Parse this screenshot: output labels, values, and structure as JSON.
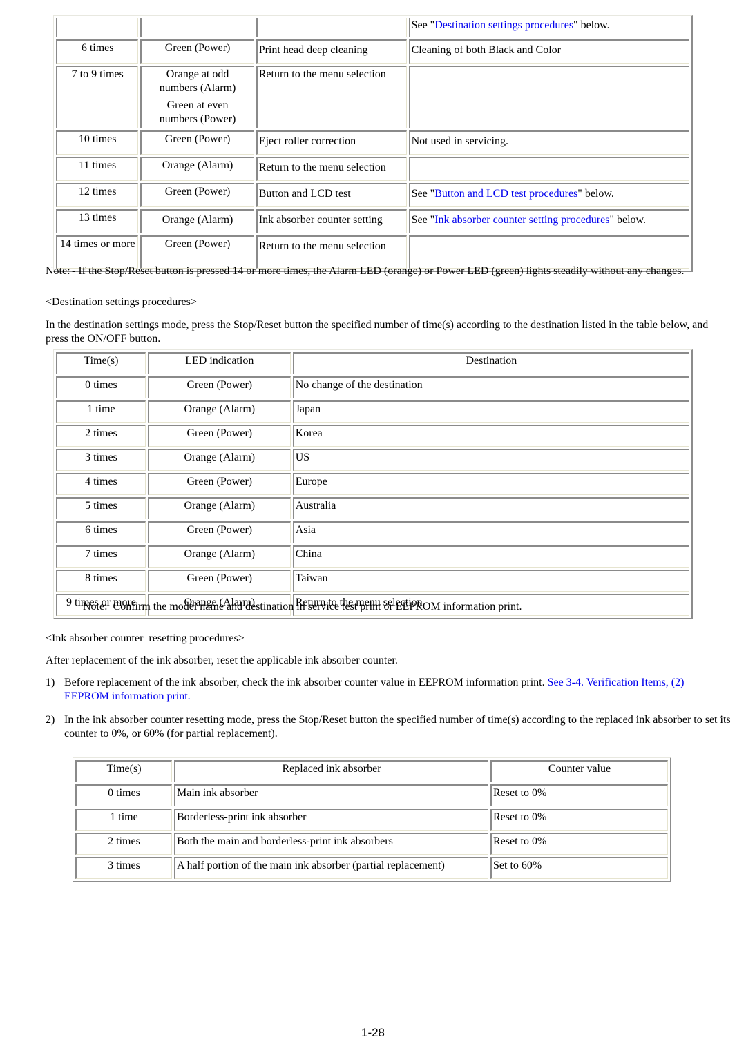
{
  "menu_table": {
    "rows": [
      {
        "times": "",
        "led": [],
        "function": "",
        "remarks_prefix": "See \"",
        "remarks_link": "Destination settings procedures",
        "remarks_suffix": "\" below."
      },
      {
        "times": "6 times",
        "led": [
          "Green (Power)"
        ],
        "function": "Print head deep cleaning",
        "remarks_text": "Cleaning of both Black and Color"
      },
      {
        "times": "7 to 9 times",
        "led": [
          "Orange at odd numbers (Alarm)",
          "Green at even numbers (Power)"
        ],
        "function": "Return to the menu selection",
        "remarks_text": ""
      },
      {
        "times": "10 times",
        "led": [
          "Green (Power)"
        ],
        "function": "Eject roller correction",
        "remarks_text": "Not used in servicing."
      },
      {
        "times": "11 times",
        "led": [
          "Orange (Alarm)"
        ],
        "function": "Return to the menu selection",
        "remarks_text": ""
      },
      {
        "times": "12 times",
        "led": [
          "Green (Power)"
        ],
        "function": "Button and LCD test",
        "remarks_prefix": "See \"",
        "remarks_link": "Button and LCD test procedures",
        "remarks_suffix": "\" below."
      },
      {
        "times": "13 times",
        "led": [
          "Orange (Alarm)"
        ],
        "function": "Ink absorber counter setting",
        "remarks_prefix": "See \"",
        "remarks_link": "Ink absorber counter setting procedures",
        "remarks_suffix": "\" below."
      },
      {
        "times": "14 times or more",
        "led": [
          "Green (Power)"
        ],
        "function": "Return to the menu selection",
        "remarks_text": ""
      }
    ]
  },
  "note1": {
    "label": "Note:",
    "text": "- If the Stop/Reset button is pressed 14 or more times, the Alarm LED (orange) or Power LED (green) lights steadily without any changes."
  },
  "destination": {
    "heading": "<Destination settings procedures>",
    "intro": "In the destination settings mode, press the Stop/Reset button the specified number of time(s) according to the destination listed in the table below, and press the ON/OFF button.",
    "headers": [
      "Time(s)",
      "LED indication",
      "Destination"
    ],
    "rows": [
      [
        "0 times",
        "Green (Power)",
        "No change of the destination"
      ],
      [
        "1 time",
        "Orange (Alarm)",
        "Japan"
      ],
      [
        "2 times",
        "Green (Power)",
        "Korea"
      ],
      [
        "3 times",
        "Orange (Alarm)",
        "US"
      ],
      [
        "4 times",
        "Green (Power)",
        "Europe"
      ],
      [
        "5 times",
        "Orange (Alarm)",
        "Australia"
      ],
      [
        "6 times",
        "Green (Power)",
        "Asia"
      ],
      [
        "7 times",
        "Orange (Alarm)",
        "China"
      ],
      [
        "8 times",
        "Green (Power)",
        "Taiwan"
      ],
      [
        "9 times or more",
        "Orange (Alarm)",
        "Return to the menu selection"
      ]
    ],
    "note": "Note:  Confirm the model name and destination in service test print or EEPROM information print."
  },
  "ink_absorber": {
    "heading": "<Ink absorber counter  resetting procedures>",
    "intro": "After replacement of the ink absorber, reset the applicable ink absorber counter.",
    "steps": [
      {
        "num": "1)",
        "text": "Before replacement of the ink absorber, check the ink absorber counter value in EEPROM information print. ",
        "link": "See 3-4. Verification Items, (2) EEPROM information print."
      },
      {
        "num": "2)",
        "text": "In the ink absorber counter resetting mode, press the Stop/Reset button the specified number of time(s) according to the replaced ink absorber to set its counter to 0%, or 60% (for partial replacement).",
        "link": ""
      }
    ],
    "headers": [
      "Time(s)",
      "Replaced ink absorber",
      "Counter value"
    ],
    "rows": [
      [
        "0 times",
        "Main ink absorber",
        "Reset to 0%"
      ],
      [
        "1 time",
        "Borderless-print ink absorber",
        "Reset to 0%"
      ],
      [
        "2 times",
        "Both the main and borderless-print ink absorbers",
        "Reset to 0%"
      ],
      [
        "3 times",
        "A half portion of the main ink absorber (partial replacement)",
        "Set to 60%"
      ]
    ]
  },
  "page_number": "1-28",
  "colors": {
    "link": "#0000ee",
    "text": "#000000",
    "cell_border_dark": "#8a8a8a",
    "cell_border_light": "#e6e4cf"
  }
}
